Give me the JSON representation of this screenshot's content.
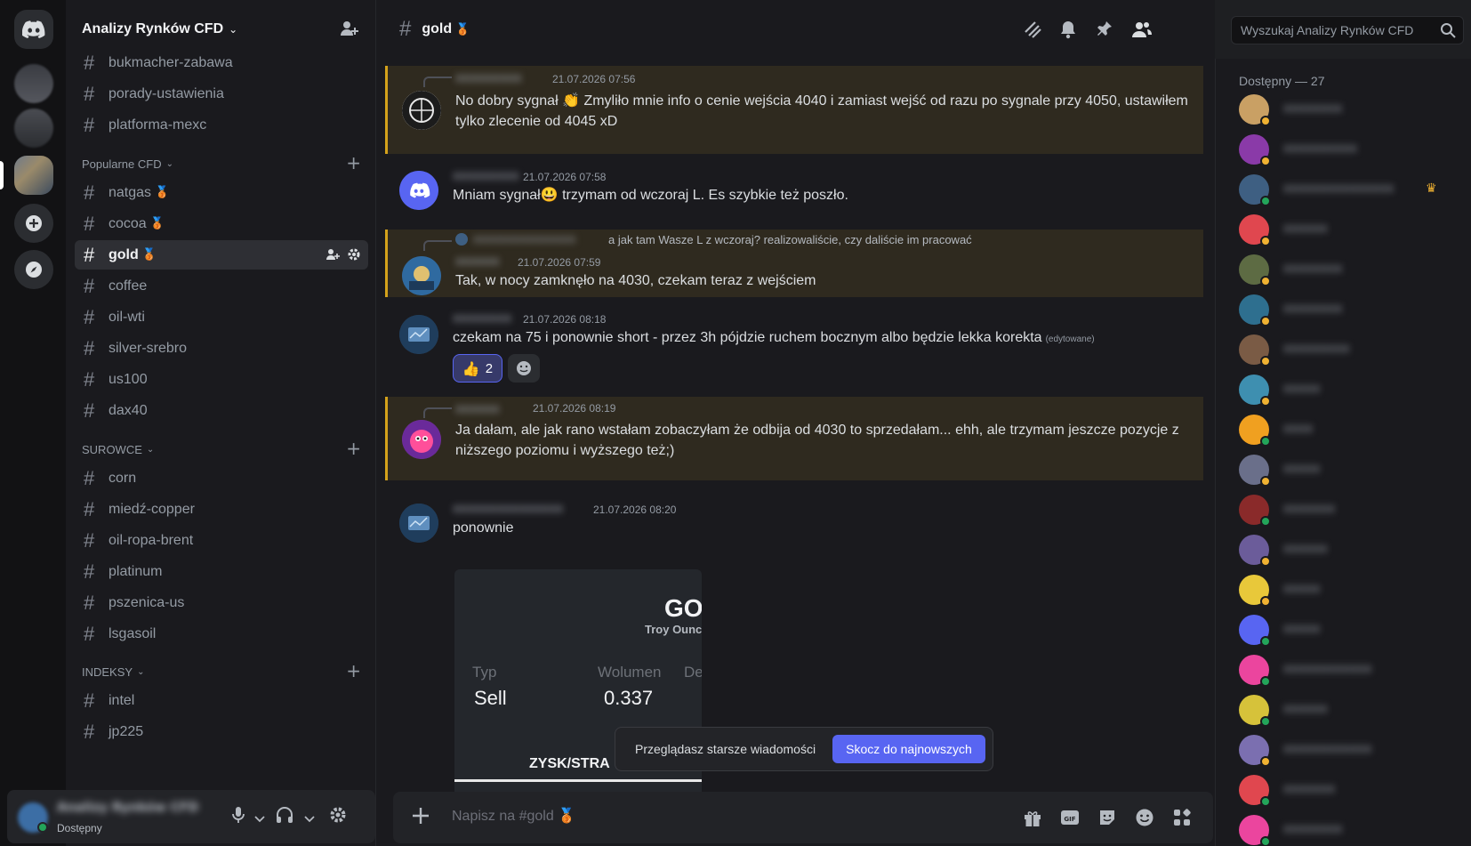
{
  "guild": {
    "name": "Analizy Rynków CFD"
  },
  "channels_top": [
    {
      "name": "bukmacher-zabawa",
      "medal": ""
    },
    {
      "name": "porady-ustawienia",
      "medal": ""
    },
    {
      "name": "platforma-mexc",
      "medal": ""
    }
  ],
  "categories": [
    {
      "label": "Popularne CFD",
      "channels": [
        {
          "name": "natgas",
          "medal": "🥉"
        },
        {
          "name": "cocoa",
          "medal": "🥉"
        },
        {
          "name": "gold",
          "medal": "🥉",
          "active": true
        },
        {
          "name": "coffee",
          "medal": ""
        },
        {
          "name": "oil-wti",
          "medal": ""
        },
        {
          "name": "silver-srebro",
          "medal": ""
        },
        {
          "name": "us100",
          "medal": ""
        },
        {
          "name": "dax40",
          "medal": ""
        }
      ]
    },
    {
      "label": "SUROWCE",
      "channels": [
        {
          "name": "corn",
          "medal": ""
        },
        {
          "name": "miedź-copper",
          "medal": ""
        },
        {
          "name": "oil-ropa-brent",
          "medal": ""
        },
        {
          "name": "platinum",
          "medal": ""
        },
        {
          "name": "pszenica-us",
          "medal": ""
        },
        {
          "name": "lsgasoil",
          "medal": ""
        }
      ]
    },
    {
      "label": "INDEKSY",
      "channels": [
        {
          "name": "intel",
          "medal": ""
        },
        {
          "name": "jp225",
          "medal": ""
        }
      ]
    }
  ],
  "current_channel": {
    "name": "gold",
    "medal": "🥉"
  },
  "search": {
    "placeholder": "Wyszukaj Analizy Rynków CFD"
  },
  "messages": [
    {
      "author": "xxxxxxxxx",
      "time": "21.07.2026 07:56",
      "text_a": "No dobry sygnał",
      "emoji": "👏",
      "text_b": " Zmyliło mnie info o cenie wejścia 4040 i zamiast wejść od razu po sygnale przy 4050, ustawiłem tylko zlecenie od 4045 xD",
      "mention": true
    },
    {
      "author": "xxxxxxxxx",
      "time": "21.07.2026 07:58",
      "text_a": "Mniam sygnał",
      "emoji": "😃",
      "text_b": " trzymam od wczoraj L. Es szybkie też poszło.",
      "mention": false
    },
    {
      "author": "xxxxxx",
      "time": "21.07.2026 07:59",
      "reply_text": "a jak tam Wasze L z wczoraj? realizowaliście, czy daliście im pracować",
      "text": "Tak, w nocy zamknęło na 4030, czekam teraz z wejściem",
      "mention": true
    },
    {
      "author": "xxxxxxxx",
      "time": "21.07.2026 08:18",
      "text": "czekam na 75 i ponownie short - przez 3h pójdzie ruchem bocznym albo będzie lekka korekta",
      "edited": "(edytowane)",
      "reaction_emoji": "👍",
      "reaction_count": "2",
      "mention": false
    },
    {
      "author": "xxxxxx",
      "time": "21.07.2026 08:19",
      "text": "Ja dałam, ale jak rano wstałam zobaczyłam że odbija od 4030 to sprzedałam... ehh, ale trzymam jeszcze pozycje z niższego poziomu i wyższego też;)",
      "mention": true
    },
    {
      "author": "xxxxxxxxxxxxxxx",
      "time": "21.07.2026 08:20",
      "text": "ponownie",
      "mention": false
    }
  ],
  "embed": {
    "title": "GOL",
    "subtitle": "Troy Ounce",
    "col1_label": "Typ",
    "col1_value": "Sell",
    "col2_label": "Wolumen",
    "col2_value": "0.337",
    "col3_label": "Dep",
    "footer": "ZYSK/STRA"
  },
  "older_bar": {
    "text": "Przeglądasz starsze wiadomości",
    "button": "Skocz do najnowszych"
  },
  "composer": {
    "placeholder": "Napisz na #gold 🥉"
  },
  "members": {
    "header": "Dostępny — 27",
    "list": [
      {
        "name": "xxxxxxxx",
        "color": "#c9a064",
        "status": "#f0b232"
      },
      {
        "name": "xxxxxxxxxx",
        "color": "#8a3aa8",
        "status": "#f0b232"
      },
      {
        "name": "xxxxxxxxxxxxxxx",
        "color": "#3e5f82",
        "status": "#23a55a",
        "crown": "♛"
      },
      {
        "name": "xxxxxx",
        "color": "#e0474f",
        "status": "#f0b232"
      },
      {
        "name": "xxxxxxxx",
        "color": "#5d6b43",
        "status": "#f0b232"
      },
      {
        "name": "xxxxxxxx",
        "color": "#2e6f8f",
        "status": "#f0b232"
      },
      {
        "name": "xxxxxxxxx",
        "color": "#7a5b45",
        "status": "#f0b232"
      },
      {
        "name": "xxxxx",
        "color": "#3e8fb0",
        "status": "#f0b232"
      },
      {
        "name": "xxxx",
        "color": "#f0a020",
        "status": "#23a55a"
      },
      {
        "name": "xxxxx",
        "color": "#6a6f8a",
        "status": "#f0b232"
      },
      {
        "name": "xxxxxxx",
        "color": "#8a2a2a",
        "status": "#23a55a"
      },
      {
        "name": "xxxxxx",
        "color": "#6b5c9a",
        "status": "#f0b232"
      },
      {
        "name": "xxxxx",
        "color": "#e8c83a",
        "status": "#f0b232"
      },
      {
        "name": "xxxxx",
        "color": "#5865f2",
        "status": "#23a55a"
      },
      {
        "name": "xxxxxxxxxxxx",
        "color": "#eb459e",
        "status": "#23a55a"
      },
      {
        "name": "xxxxxx",
        "color": "#d6c23a",
        "status": "#23a55a"
      },
      {
        "name": "xxxxxxxxxxxx",
        "color": "#7b6fb0",
        "status": "#f0b232"
      },
      {
        "name": "xxxxxxx",
        "color": "#e0474f",
        "status": "#23a55a"
      },
      {
        "name": "xxxxxxxx",
        "color": "#eb459e",
        "status": "#23a55a"
      }
    ]
  },
  "user_panel": {
    "name": "Analizy Rynków CFD",
    "status": "Dostępny"
  }
}
